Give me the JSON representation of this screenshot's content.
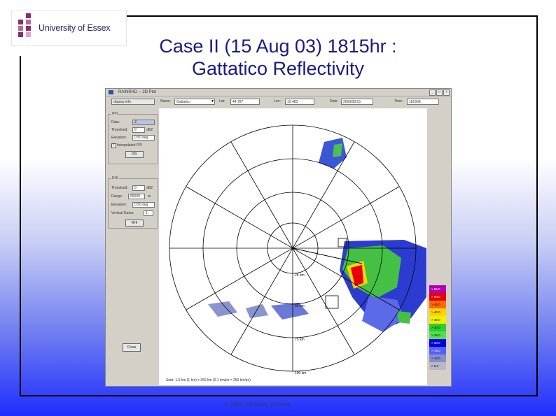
{
  "logo": {
    "text": "University of Essex"
  },
  "title": {
    "line1": "Case II (15 Aug 03) 1815hr :",
    "line2": "Gattatico Reflectivity"
  },
  "app": {
    "window_title": "RAINRAD -- 2D Plot",
    "toolbar": {
      "display_select": "display info",
      "name_label": "Name:",
      "name_value": "Gattatico",
      "lat_label": "Lat:",
      "lat_value": "44.787",
      "lon_label": "Lon:",
      "lon_value": "10.483",
      "date_label": "Date:",
      "date_value": "2003/08/15",
      "time_label": "Time:",
      "time_value": "181508"
    },
    "ppi_group": {
      "label": "PPI",
      "data_label": "Data:",
      "data_value": "Z",
      "threshold_label": "Threshold:",
      "threshold_value": "0",
      "threshold_unit": "dBZ",
      "elevation_label": "Elevation:",
      "elevation_value": "0.50 deg",
      "interpolated_label": "Interpolated PPI",
      "plot_button": "PPI"
    },
    "rhi_group": {
      "label": "RHI",
      "threshold_label": "Threshold:",
      "threshold_value": "0",
      "threshold_unit": "dBZ",
      "range_label": "Range:",
      "range_value": "65000",
      "range_unit": "m",
      "elevation_label": "Elevation:",
      "elevation_value": "0.50 deg",
      "gate_label": "Vertical Gates:",
      "gate_value": "1",
      "plot_button": "RHI"
    },
    "close_button": "Close",
    "status": "Start: 1.5 km (1 km) x 250 km (0.1 km/px = 250 km/px)",
    "range_labels": [
      "25 km",
      "50 km",
      "75 km",
      "100 km"
    ],
    "legend": [
      {
        "label": "> 55.0",
        "color": "#b000b0"
      },
      {
        "label": "> 50.0",
        "color": "#e80000"
      },
      {
        "label": "> 45.0",
        "color": "#ff6a00"
      },
      {
        "label": "> 40.0",
        "color": "#ffd400"
      },
      {
        "label": "> 35.0",
        "color": "#f0f000"
      },
      {
        "label": "> 30.0",
        "color": "#30cc30"
      },
      {
        "label": "> 25.0",
        "color": "#50e050"
      },
      {
        "label": "> 20.0",
        "color": "#0000e0"
      },
      {
        "label": "> 15.0",
        "color": "#5060ff"
      },
      {
        "label": "> 10.0",
        "color": "#8890c8"
      },
      {
        "label": "> 5.0",
        "color": "#b8b8c8"
      }
    ]
  },
  "footer": {
    "text": "© 2003 University of Essex"
  }
}
